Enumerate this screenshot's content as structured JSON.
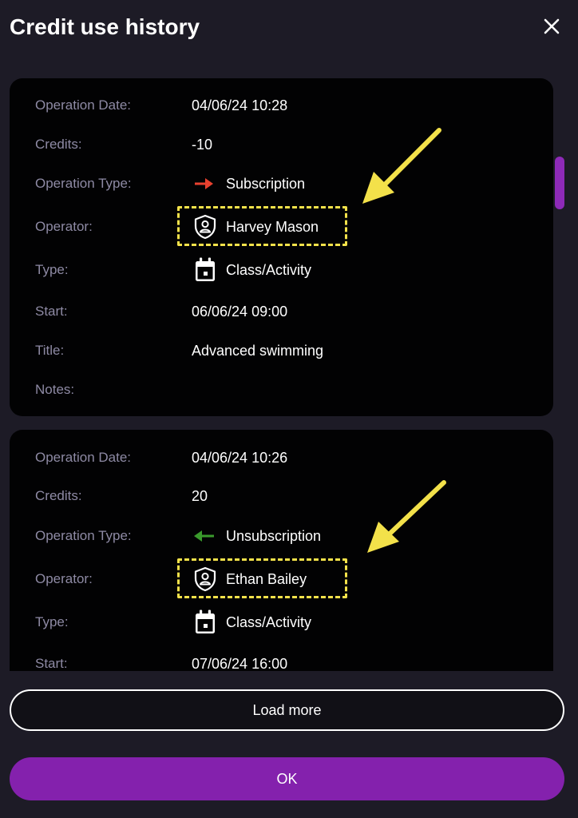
{
  "dialog": {
    "title": "Credit use history"
  },
  "records": [
    {
      "operation_date_label": "Operation Date:",
      "operation_date": "04/06/24 10:28",
      "credits_label": "Credits:",
      "credits": "-10",
      "operation_type_label": "Operation Type:",
      "operation_type": "Subscription",
      "operation_type_icon": "arrow-right-icon",
      "operation_type_color": "#e8412f",
      "operator_label": "Operator:",
      "operator": "Harvey Mason",
      "operator_icon": "shield-user-icon",
      "type_label": "Type:",
      "type": "Class/Activity",
      "type_icon": "calendar-icon",
      "start_label": "Start:",
      "start": "06/06/24 09:00",
      "title_label": "Title:",
      "title": "Advanced swimming",
      "notes_label": "Notes:",
      "notes": ""
    },
    {
      "operation_date_label": "Operation Date:",
      "operation_date": "04/06/24 10:26",
      "credits_label": "Credits:",
      "credits": "20",
      "operation_type_label": "Operation Type:",
      "operation_type": "Unsubscription",
      "operation_type_icon": "arrow-left-icon",
      "operation_type_color": "#3a9a2c",
      "operator_label": "Operator:",
      "operator": "Ethan Bailey",
      "operator_icon": "shield-user-icon",
      "type_label": "Type:",
      "type": "Class/Activity",
      "type_icon": "calendar-icon",
      "start_label": "Start:",
      "start": "07/06/24 16:00"
    }
  ],
  "buttons": {
    "load_more": "Load more",
    "ok": "OK"
  },
  "colors": {
    "accent": "#8421ad",
    "annotation": "#f3e14a",
    "background": "#1d1b26",
    "card": "#020203"
  }
}
